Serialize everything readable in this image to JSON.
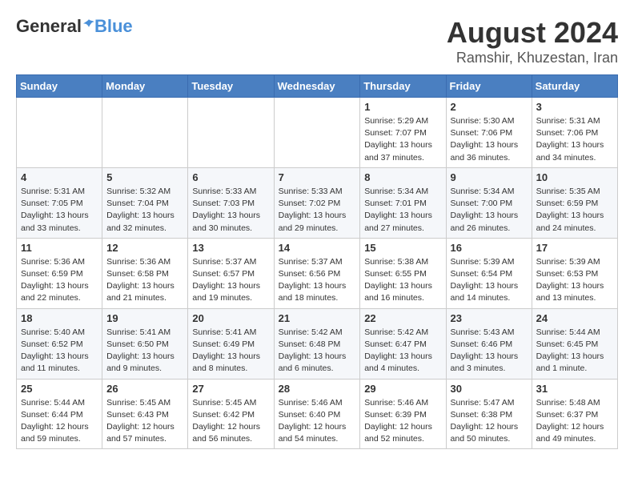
{
  "header": {
    "logo": {
      "general": "General",
      "blue": "Blue"
    },
    "title": "August 2024",
    "location": "Ramshir, Khuzestan, Iran"
  },
  "weekdays": [
    "Sunday",
    "Monday",
    "Tuesday",
    "Wednesday",
    "Thursday",
    "Friday",
    "Saturday"
  ],
  "weeks": [
    [
      {
        "day": "",
        "info": ""
      },
      {
        "day": "",
        "info": ""
      },
      {
        "day": "",
        "info": ""
      },
      {
        "day": "",
        "info": ""
      },
      {
        "day": "1",
        "info": "Sunrise: 5:29 AM\nSunset: 7:07 PM\nDaylight: 13 hours\nand 37 minutes."
      },
      {
        "day": "2",
        "info": "Sunrise: 5:30 AM\nSunset: 7:06 PM\nDaylight: 13 hours\nand 36 minutes."
      },
      {
        "day": "3",
        "info": "Sunrise: 5:31 AM\nSunset: 7:06 PM\nDaylight: 13 hours\nand 34 minutes."
      }
    ],
    [
      {
        "day": "4",
        "info": "Sunrise: 5:31 AM\nSunset: 7:05 PM\nDaylight: 13 hours\nand 33 minutes."
      },
      {
        "day": "5",
        "info": "Sunrise: 5:32 AM\nSunset: 7:04 PM\nDaylight: 13 hours\nand 32 minutes."
      },
      {
        "day": "6",
        "info": "Sunrise: 5:33 AM\nSunset: 7:03 PM\nDaylight: 13 hours\nand 30 minutes."
      },
      {
        "day": "7",
        "info": "Sunrise: 5:33 AM\nSunset: 7:02 PM\nDaylight: 13 hours\nand 29 minutes."
      },
      {
        "day": "8",
        "info": "Sunrise: 5:34 AM\nSunset: 7:01 PM\nDaylight: 13 hours\nand 27 minutes."
      },
      {
        "day": "9",
        "info": "Sunrise: 5:34 AM\nSunset: 7:00 PM\nDaylight: 13 hours\nand 26 minutes."
      },
      {
        "day": "10",
        "info": "Sunrise: 5:35 AM\nSunset: 6:59 PM\nDaylight: 13 hours\nand 24 minutes."
      }
    ],
    [
      {
        "day": "11",
        "info": "Sunrise: 5:36 AM\nSunset: 6:59 PM\nDaylight: 13 hours\nand 22 minutes."
      },
      {
        "day": "12",
        "info": "Sunrise: 5:36 AM\nSunset: 6:58 PM\nDaylight: 13 hours\nand 21 minutes."
      },
      {
        "day": "13",
        "info": "Sunrise: 5:37 AM\nSunset: 6:57 PM\nDaylight: 13 hours\nand 19 minutes."
      },
      {
        "day": "14",
        "info": "Sunrise: 5:37 AM\nSunset: 6:56 PM\nDaylight: 13 hours\nand 18 minutes."
      },
      {
        "day": "15",
        "info": "Sunrise: 5:38 AM\nSunset: 6:55 PM\nDaylight: 13 hours\nand 16 minutes."
      },
      {
        "day": "16",
        "info": "Sunrise: 5:39 AM\nSunset: 6:54 PM\nDaylight: 13 hours\nand 14 minutes."
      },
      {
        "day": "17",
        "info": "Sunrise: 5:39 AM\nSunset: 6:53 PM\nDaylight: 13 hours\nand 13 minutes."
      }
    ],
    [
      {
        "day": "18",
        "info": "Sunrise: 5:40 AM\nSunset: 6:52 PM\nDaylight: 13 hours\nand 11 minutes."
      },
      {
        "day": "19",
        "info": "Sunrise: 5:41 AM\nSunset: 6:50 PM\nDaylight: 13 hours\nand 9 minutes."
      },
      {
        "day": "20",
        "info": "Sunrise: 5:41 AM\nSunset: 6:49 PM\nDaylight: 13 hours\nand 8 minutes."
      },
      {
        "day": "21",
        "info": "Sunrise: 5:42 AM\nSunset: 6:48 PM\nDaylight: 13 hours\nand 6 minutes."
      },
      {
        "day": "22",
        "info": "Sunrise: 5:42 AM\nSunset: 6:47 PM\nDaylight: 13 hours\nand 4 minutes."
      },
      {
        "day": "23",
        "info": "Sunrise: 5:43 AM\nSunset: 6:46 PM\nDaylight: 13 hours\nand 3 minutes."
      },
      {
        "day": "24",
        "info": "Sunrise: 5:44 AM\nSunset: 6:45 PM\nDaylight: 13 hours\nand 1 minute."
      }
    ],
    [
      {
        "day": "25",
        "info": "Sunrise: 5:44 AM\nSunset: 6:44 PM\nDaylight: 12 hours\nand 59 minutes."
      },
      {
        "day": "26",
        "info": "Sunrise: 5:45 AM\nSunset: 6:43 PM\nDaylight: 12 hours\nand 57 minutes."
      },
      {
        "day": "27",
        "info": "Sunrise: 5:45 AM\nSunset: 6:42 PM\nDaylight: 12 hours\nand 56 minutes."
      },
      {
        "day": "28",
        "info": "Sunrise: 5:46 AM\nSunset: 6:40 PM\nDaylight: 12 hours\nand 54 minutes."
      },
      {
        "day": "29",
        "info": "Sunrise: 5:46 AM\nSunset: 6:39 PM\nDaylight: 12 hours\nand 52 minutes."
      },
      {
        "day": "30",
        "info": "Sunrise: 5:47 AM\nSunset: 6:38 PM\nDaylight: 12 hours\nand 50 minutes."
      },
      {
        "day": "31",
        "info": "Sunrise: 5:48 AM\nSunset: 6:37 PM\nDaylight: 12 hours\nand 49 minutes."
      }
    ]
  ]
}
